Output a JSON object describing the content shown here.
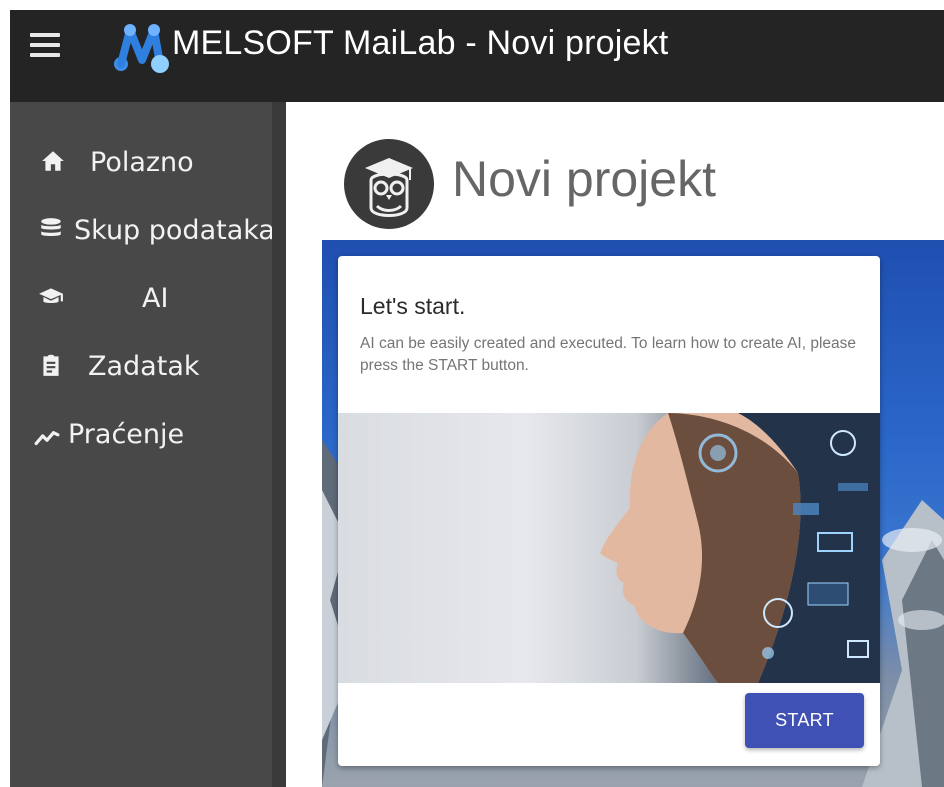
{
  "appbar": {
    "title": "MELSOFT MaiLab - Novi projekt",
    "menu_icon": "hamburger-menu-icon",
    "logo_icon": "melsoft-logo-icon"
  },
  "sidebar": {
    "items": [
      {
        "label": "Polazno",
        "icon": "home-icon"
      },
      {
        "label": "Skup podataka",
        "icon": "database-icon"
      },
      {
        "label": "AI",
        "icon": "graduation-cap-icon"
      },
      {
        "label": "Zadatak",
        "icon": "clipboard-icon"
      },
      {
        "label": "Praćenje",
        "icon": "trending-line-icon"
      }
    ]
  },
  "main": {
    "page_title": "Novi projekt",
    "page_icon": "owl-graduate-icon"
  },
  "card": {
    "title": "Let's start.",
    "text": "AI can be easily created and executed. To learn how to create AI, please press the START button.",
    "start_label": "START"
  },
  "colors": {
    "appbar_bg": "#242424",
    "sidebar_bg": "#484848",
    "accent": "#3f51b5",
    "panel_blue": "#2a66c8"
  }
}
